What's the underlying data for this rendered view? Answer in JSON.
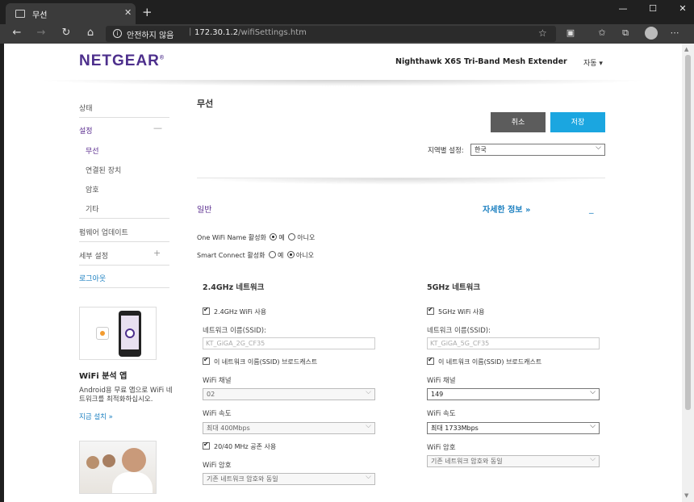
{
  "browser": {
    "tab_title": "무선",
    "tab_close": "✕",
    "new_tab": "+",
    "security": "안전하지 않음",
    "url_host": "172.30.1.2",
    "url_path": "/wifiSettings.htm"
  },
  "header": {
    "brand": "NETGEAR",
    "brand_mark": "®",
    "product": "Nighthawk X6S Tri-Band Mesh Extender",
    "language": "자동 ▾"
  },
  "sidebar": {
    "status": "상태",
    "settings": "설정",
    "settings_sign": "—",
    "wireless": "무선",
    "connected": "연결된 장치",
    "password": "암호",
    "other": "기타",
    "firmware": "펌웨어 업데이트",
    "advanced": "세부 설정",
    "advanced_sign": "+",
    "logout": "로그아웃"
  },
  "app_promo": {
    "title": "WiFi 분석 앱",
    "desc": "Android용 무료 앱으로 WiFi 네트워크를 최적화하십시오.",
    "install": "지금 설치 »"
  },
  "main": {
    "title": "무선",
    "cancel": "취소",
    "save": "저장",
    "region_label": "지역별 설정:",
    "region_value": "한국",
    "section_general": "일반",
    "detail_link": "자세한 정보 »",
    "collapse": "_",
    "onewifi_label": "One WiFi Name 활성화",
    "smart_label": "Smart Connect 활성화",
    "yes": "예",
    "no": "아니오"
  },
  "net24": {
    "title": "2.4GHz 네트워크",
    "enable": "2.4GHz WiFi 사용",
    "ssid_label": "네트워크 이름(SSID):",
    "ssid_value": "KT_GiGA_2G_CF35",
    "broadcast": "이 네트워크 이름(SSID) 브로드캐스트",
    "channel_label": "WiFi 채널",
    "channel_value": "02",
    "speed_label": "WiFi 속도",
    "speed_value": "최대 400Mbps",
    "coexist": "20/40 MHz 공존 사용",
    "security_label": "WiFi 암호",
    "security_value": "기존 네트워크 암호와 동일"
  },
  "net5": {
    "title": "5GHz 네트워크",
    "enable": "5GHz WiFi 사용",
    "ssid_label": "네트워크 이름(SSID):",
    "ssid_value": "KT_GiGA_5G_CF35",
    "broadcast": "이 네트워크 이름(SSID) 브로드캐스트",
    "channel_label": "WiFi 채널",
    "channel_value": "149",
    "speed_label": "WiFi 속도",
    "speed_value": "최대 1733Mbps",
    "security_label": "WiFi 암호",
    "security_value": "기존 네트워크 암호와 동일"
  },
  "colors": {
    "brand": "#4d2f8c",
    "link": "#1a7fc0",
    "save": "#1ba6e0",
    "cancel": "#5c5c5c"
  }
}
